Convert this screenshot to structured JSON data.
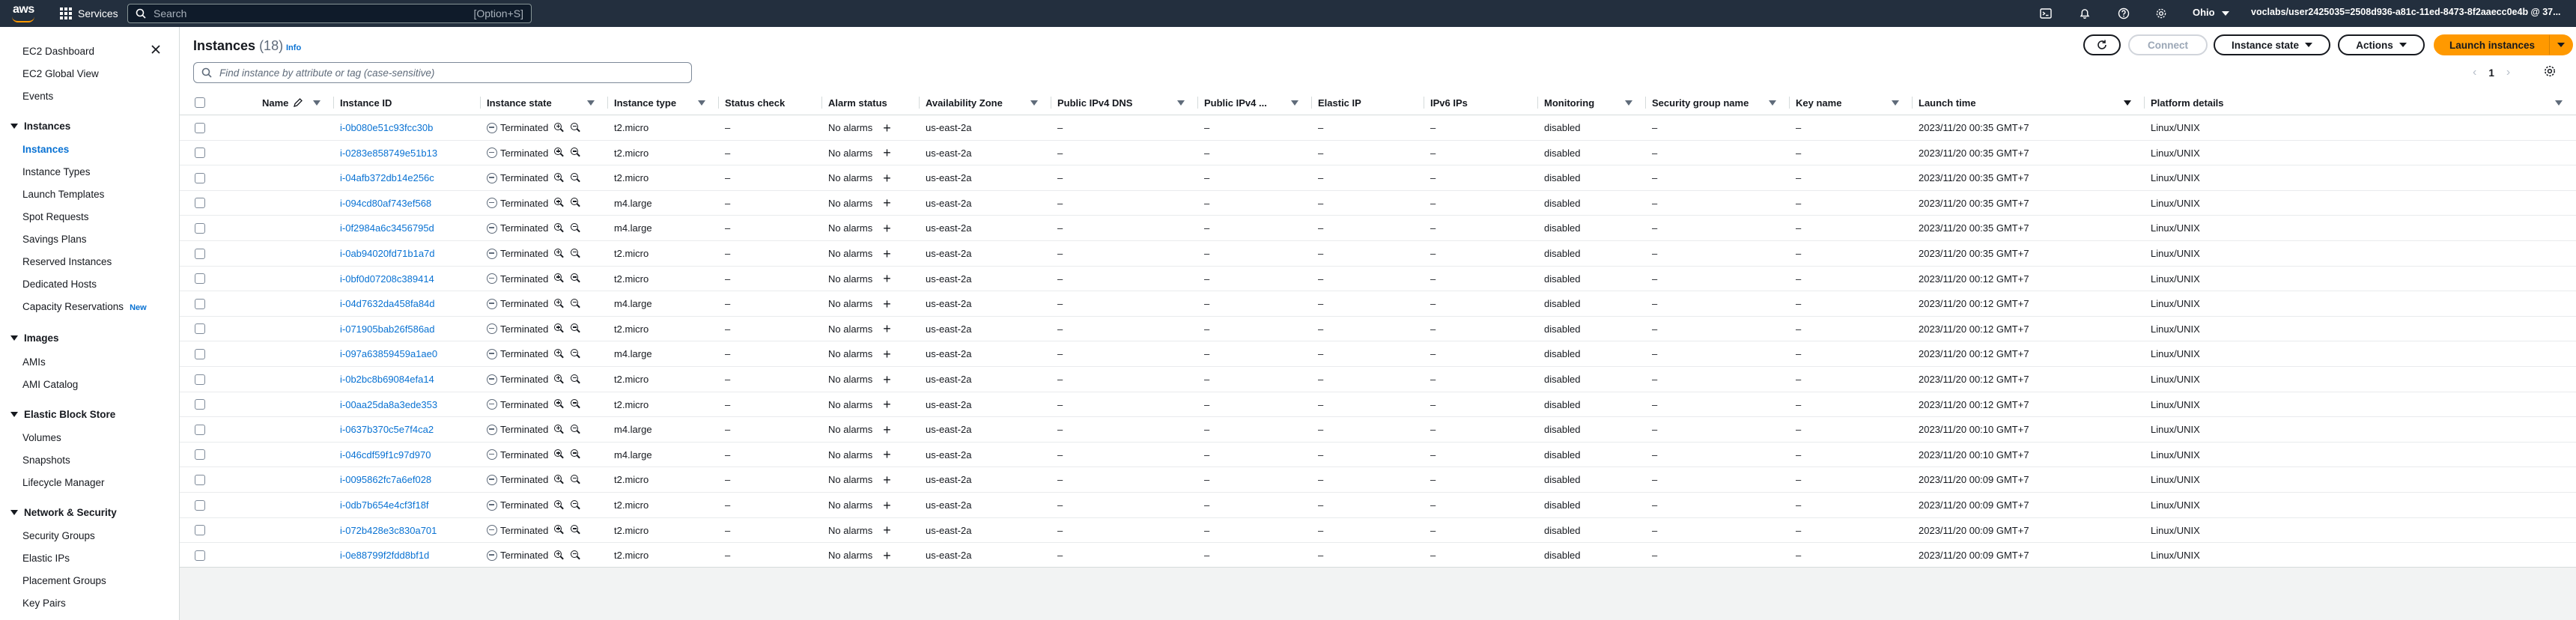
{
  "topnav": {
    "logo_text": "aws",
    "services_label": "Services",
    "search_placeholder": "Search",
    "search_shortcut": "[Option+S]",
    "region": "Ohio",
    "account": "voclabs/user2425035=2508d936-a81c-11ed-8473-8f2aaecc0e4b @ 37...",
    "colors": {
      "bg": "#232f3e",
      "accent": "#ff9900"
    }
  },
  "sidebar": {
    "top_links": [
      {
        "label": "EC2 Dashboard"
      },
      {
        "label": "EC2 Global View"
      },
      {
        "label": "Events"
      }
    ],
    "sections": [
      {
        "title": "Instances",
        "items": [
          {
            "label": "Instances",
            "active": true
          },
          {
            "label": "Instance Types"
          },
          {
            "label": "Launch Templates"
          },
          {
            "label": "Spot Requests"
          },
          {
            "label": "Savings Plans"
          },
          {
            "label": "Reserved Instances"
          },
          {
            "label": "Dedicated Hosts"
          },
          {
            "label": "Capacity Reservations",
            "badge": "New"
          }
        ]
      },
      {
        "title": "Images",
        "items": [
          {
            "label": "AMIs"
          },
          {
            "label": "AMI Catalog"
          }
        ]
      },
      {
        "title": "Elastic Block Store",
        "items": [
          {
            "label": "Volumes"
          },
          {
            "label": "Snapshots"
          },
          {
            "label": "Lifecycle Manager"
          }
        ]
      },
      {
        "title": "Network & Security",
        "items": [
          {
            "label": "Security Groups"
          },
          {
            "label": "Elastic IPs"
          },
          {
            "label": "Placement Groups"
          },
          {
            "label": "Key Pairs"
          }
        ]
      }
    ]
  },
  "main": {
    "title": "Instances",
    "count": "(18)",
    "info_label": "Info",
    "filter_placeholder": "Find instance by attribute or tag (case-sensitive)",
    "buttons": {
      "connect": "Connect",
      "instance_state": "Instance state",
      "actions": "Actions",
      "launch": "Launch instances"
    },
    "pager": {
      "prev": "‹",
      "page": "1",
      "next": "›"
    }
  },
  "table": {
    "columns": [
      "Name",
      "Instance ID",
      "Instance state",
      "Instance type",
      "Status check",
      "Alarm status",
      "Availability Zone",
      "Public IPv4 DNS",
      "Public IPv4 ...",
      "Elastic IP",
      "IPv6 IPs",
      "Monitoring",
      "Security group name",
      "Key name",
      "Launch time",
      "Platform details"
    ],
    "rows": [
      {
        "id": "i-0b080e51c93fcc30b",
        "state": "Terminated",
        "type": "t2.micro",
        "status": "–",
        "alarm": "No alarms",
        "az": "us-east-2a",
        "dns": "–",
        "ipv4": "–",
        "eip": "–",
        "ipv6": "–",
        "monitoring": "disabled",
        "sg": "–",
        "key": "–",
        "launch": "2023/11/20 00:35 GMT+7",
        "platform": "Linux/UNIX"
      },
      {
        "id": "i-0283e858749e51b13",
        "state": "Terminated",
        "type": "t2.micro",
        "status": "–",
        "alarm": "No alarms",
        "az": "us-east-2a",
        "dns": "–",
        "ipv4": "–",
        "eip": "–",
        "ipv6": "–",
        "monitoring": "disabled",
        "sg": "–",
        "key": "–",
        "launch": "2023/11/20 00:35 GMT+7",
        "platform": "Linux/UNIX"
      },
      {
        "id": "i-04afb372db14e256c",
        "state": "Terminated",
        "type": "t2.micro",
        "status": "–",
        "alarm": "No alarms",
        "az": "us-east-2a",
        "dns": "–",
        "ipv4": "–",
        "eip": "–",
        "ipv6": "–",
        "monitoring": "disabled",
        "sg": "–",
        "key": "–",
        "launch": "2023/11/20 00:35 GMT+7",
        "platform": "Linux/UNIX"
      },
      {
        "id": "i-094cd80af743ef568",
        "state": "Terminated",
        "type": "m4.large",
        "status": "–",
        "alarm": "No alarms",
        "az": "us-east-2a",
        "dns": "–",
        "ipv4": "–",
        "eip": "–",
        "ipv6": "–",
        "monitoring": "disabled",
        "sg": "–",
        "key": "–",
        "launch": "2023/11/20 00:35 GMT+7",
        "platform": "Linux/UNIX"
      },
      {
        "id": "i-0f2984a6c3456795d",
        "state": "Terminated",
        "type": "m4.large",
        "status": "–",
        "alarm": "No alarms",
        "az": "us-east-2a",
        "dns": "–",
        "ipv4": "–",
        "eip": "–",
        "ipv6": "–",
        "monitoring": "disabled",
        "sg": "–",
        "key": "–",
        "launch": "2023/11/20 00:35 GMT+7",
        "platform": "Linux/UNIX"
      },
      {
        "id": "i-0ab94020fd71b1a7d",
        "state": "Terminated",
        "type": "t2.micro",
        "status": "–",
        "alarm": "No alarms",
        "az": "us-east-2a",
        "dns": "–",
        "ipv4": "–",
        "eip": "–",
        "ipv6": "–",
        "monitoring": "disabled",
        "sg": "–",
        "key": "–",
        "launch": "2023/11/20 00:35 GMT+7",
        "platform": "Linux/UNIX"
      },
      {
        "id": "i-0bf0d07208c389414",
        "state": "Terminated",
        "type": "t2.micro",
        "status": "–",
        "alarm": "No alarms",
        "az": "us-east-2a",
        "dns": "–",
        "ipv4": "–",
        "eip": "–",
        "ipv6": "–",
        "monitoring": "disabled",
        "sg": "–",
        "key": "–",
        "launch": "2023/11/20 00:12 GMT+7",
        "platform": "Linux/UNIX"
      },
      {
        "id": "i-04d7632da458fa84d",
        "state": "Terminated",
        "type": "m4.large",
        "status": "–",
        "alarm": "No alarms",
        "az": "us-east-2a",
        "dns": "–",
        "ipv4": "–",
        "eip": "–",
        "ipv6": "–",
        "monitoring": "disabled",
        "sg": "–",
        "key": "–",
        "launch": "2023/11/20 00:12 GMT+7",
        "platform": "Linux/UNIX"
      },
      {
        "id": "i-071905bab26f586ad",
        "state": "Terminated",
        "type": "t2.micro",
        "status": "–",
        "alarm": "No alarms",
        "az": "us-east-2a",
        "dns": "–",
        "ipv4": "–",
        "eip": "–",
        "ipv6": "–",
        "monitoring": "disabled",
        "sg": "–",
        "key": "–",
        "launch": "2023/11/20 00:12 GMT+7",
        "platform": "Linux/UNIX"
      },
      {
        "id": "i-097a63859459a1ae0",
        "state": "Terminated",
        "type": "m4.large",
        "status": "–",
        "alarm": "No alarms",
        "az": "us-east-2a",
        "dns": "–",
        "ipv4": "–",
        "eip": "–",
        "ipv6": "–",
        "monitoring": "disabled",
        "sg": "–",
        "key": "–",
        "launch": "2023/11/20 00:12 GMT+7",
        "platform": "Linux/UNIX"
      },
      {
        "id": "i-0b2bc8b69084efa14",
        "state": "Terminated",
        "type": "t2.micro",
        "status": "–",
        "alarm": "No alarms",
        "az": "us-east-2a",
        "dns": "–",
        "ipv4": "–",
        "eip": "–",
        "ipv6": "–",
        "monitoring": "disabled",
        "sg": "–",
        "key": "–",
        "launch": "2023/11/20 00:12 GMT+7",
        "platform": "Linux/UNIX"
      },
      {
        "id": "i-00aa25da8a3ede353",
        "state": "Terminated",
        "type": "t2.micro",
        "status": "–",
        "alarm": "No alarms",
        "az": "us-east-2a",
        "dns": "–",
        "ipv4": "–",
        "eip": "–",
        "ipv6": "–",
        "monitoring": "disabled",
        "sg": "–",
        "key": "–",
        "launch": "2023/11/20 00:12 GMT+7",
        "platform": "Linux/UNIX"
      },
      {
        "id": "i-0637b370c5e7f4ca2",
        "state": "Terminated",
        "type": "m4.large",
        "status": "–",
        "alarm": "No alarms",
        "az": "us-east-2a",
        "dns": "–",
        "ipv4": "–",
        "eip": "–",
        "ipv6": "–",
        "monitoring": "disabled",
        "sg": "–",
        "key": "–",
        "launch": "2023/11/20 00:10 GMT+7",
        "platform": "Linux/UNIX"
      },
      {
        "id": "i-046cdf59f1c97d970",
        "state": "Terminated",
        "type": "m4.large",
        "status": "–",
        "alarm": "No alarms",
        "az": "us-east-2a",
        "dns": "–",
        "ipv4": "–",
        "eip": "–",
        "ipv6": "–",
        "monitoring": "disabled",
        "sg": "–",
        "key": "–",
        "launch": "2023/11/20 00:10 GMT+7",
        "platform": "Linux/UNIX"
      },
      {
        "id": "i-0095862fc7a6ef028",
        "state": "Terminated",
        "type": "t2.micro",
        "status": "–",
        "alarm": "No alarms",
        "az": "us-east-2a",
        "dns": "–",
        "ipv4": "–",
        "eip": "–",
        "ipv6": "–",
        "monitoring": "disabled",
        "sg": "–",
        "key": "–",
        "launch": "2023/11/20 00:09 GMT+7",
        "platform": "Linux/UNIX"
      },
      {
        "id": "i-0db7b654e4cf3f18f",
        "state": "Terminated",
        "type": "t2.micro",
        "status": "–",
        "alarm": "No alarms",
        "az": "us-east-2a",
        "dns": "–",
        "ipv4": "–",
        "eip": "–",
        "ipv6": "–",
        "monitoring": "disabled",
        "sg": "–",
        "key": "–",
        "launch": "2023/11/20 00:09 GMT+7",
        "platform": "Linux/UNIX"
      },
      {
        "id": "i-072b428e3c830a701",
        "state": "Terminated",
        "type": "t2.micro",
        "status": "–",
        "alarm": "No alarms",
        "az": "us-east-2a",
        "dns": "–",
        "ipv4": "–",
        "eip": "–",
        "ipv6": "–",
        "monitoring": "disabled",
        "sg": "–",
        "key": "–",
        "launch": "2023/11/20 00:09 GMT+7",
        "platform": "Linux/UNIX"
      },
      {
        "id": "i-0e88799f2fdd8bf1d",
        "state": "Terminated",
        "type": "t2.micro",
        "status": "–",
        "alarm": "No alarms",
        "az": "us-east-2a",
        "dns": "–",
        "ipv4": "–",
        "eip": "–",
        "ipv6": "–",
        "monitoring": "disabled",
        "sg": "–",
        "key": "–",
        "launch": "2023/11/20 00:09 GMT+7",
        "platform": "Linux/UNIX"
      }
    ]
  }
}
